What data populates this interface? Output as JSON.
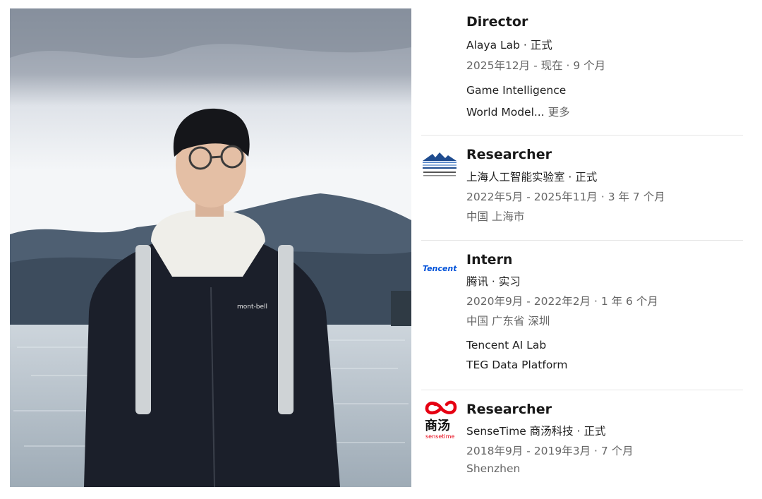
{
  "profile_photo": {
    "label": "profile-photo",
    "jacket_logo_text": "mont-bell"
  },
  "experience": [
    {
      "title": "Director",
      "company": "Alaya Lab · 正式",
      "dates": "2025年12月 - 现在 · 9 个月",
      "description_lines": [
        "Game Intelligence",
        "World Model..."
      ],
      "more_label": "更多",
      "logo": "none"
    },
    {
      "title": "Researcher",
      "company": "上海人工智能实验室 · 正式",
      "dates": "2022年5月 - 2025年11月 · 3 年 7 个月",
      "location": "中国 上海市",
      "logo": "shanghai-ai-lab-logo"
    },
    {
      "title": "Intern",
      "company": "腾讯 · 实习",
      "dates": "2020年9月 - 2022年2月 · 1 年 6 个月",
      "location": "中国 广东省 深圳",
      "description_lines": [
        "Tencent AI Lab",
        "TEG Data Platform"
      ],
      "logo": "tencent-logo",
      "logo_text": "Tencent"
    },
    {
      "title": "Researcher",
      "company": "SenseTime 商汤科技 · 正式",
      "dates": "2018年9月 - 2019年3月 · 7 个月",
      "location": "Shenzhen",
      "logo": "sensetime-logo",
      "logo_text_cn": "商汤",
      "logo_text_en": "sensetime"
    }
  ],
  "colors": {
    "separator": "#e6e6e6",
    "meta_text": "#666666",
    "tencent_blue": "#0052d9",
    "sensetime_red": "#e60012"
  }
}
